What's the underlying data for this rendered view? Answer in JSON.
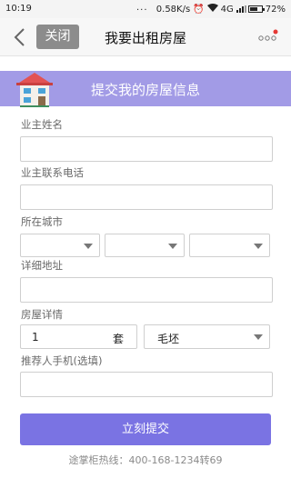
{
  "status_bar": {
    "time": "10:19",
    "dots": "...",
    "speed": "0.58K/s",
    "network": "4G",
    "battery": "72%",
    "battery_level": 0.72
  },
  "nav": {
    "close_label": "关闭",
    "title": "我要出租房屋",
    "accent_color": "#e53935"
  },
  "banner": {
    "title": "提交我的房屋信息",
    "color": "#a29be6"
  },
  "form": {
    "owner_name_label": "业主姓名",
    "owner_name_value": "",
    "owner_phone_label": "业主联系电话",
    "owner_phone_value": "",
    "city_label": "所在城市",
    "city_selects": [
      "",
      "",
      ""
    ],
    "address_label": "详细地址",
    "address_value": "",
    "detail_label": "房屋详情",
    "quantity_value": "1",
    "quantity_unit": "套",
    "decoration_value": "毛坯",
    "referrer_label": "推荐人手机(选填)",
    "referrer_value": ""
  },
  "submit": {
    "label": "立刻提交",
    "color": "#7a73e3"
  },
  "footer": {
    "hotline_text": "途掌柜热线：400-168-1234转69"
  }
}
